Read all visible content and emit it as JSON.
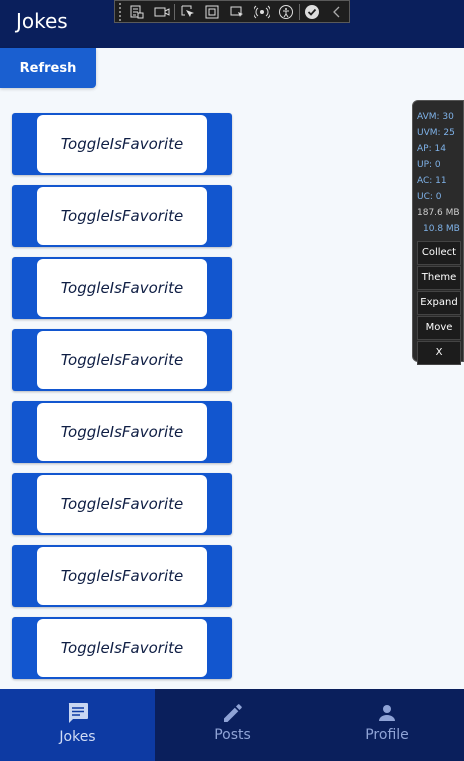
{
  "app": {
    "title": "Jokes"
  },
  "toolbar": {
    "refresh_label": "Refresh"
  },
  "jokes": [
    {
      "label": "ToggleIsFavorite"
    },
    {
      "label": "ToggleIsFavorite"
    },
    {
      "label": "ToggleIsFavorite"
    },
    {
      "label": "ToggleIsFavorite"
    },
    {
      "label": "ToggleIsFavorite"
    },
    {
      "label": "ToggleIsFavorite"
    },
    {
      "label": "ToggleIsFavorite"
    },
    {
      "label": "ToggleIsFavorite"
    }
  ],
  "diagnostics": {
    "avm": "AVM: 30",
    "uvm": "UVM: 25",
    "ap": "AP: 14",
    "up": "UP: 0",
    "ac": "AC: 11",
    "uc": "UC: 0",
    "memory1": "187.6 MB",
    "memory2": "10.8 MB",
    "buttons": [
      "Collect",
      "Theme",
      "Expand",
      "Move",
      "X"
    ]
  },
  "tabs": [
    {
      "label": "Jokes",
      "icon": "chat-icon",
      "active": true
    },
    {
      "label": "Posts",
      "icon": "pencil-icon",
      "active": false
    },
    {
      "label": "Profile",
      "icon": "person-icon",
      "active": false
    }
  ],
  "colors": {
    "header": "#0a1f5c",
    "accent": "#1256cf",
    "active_tab": "#0d3aa3"
  }
}
